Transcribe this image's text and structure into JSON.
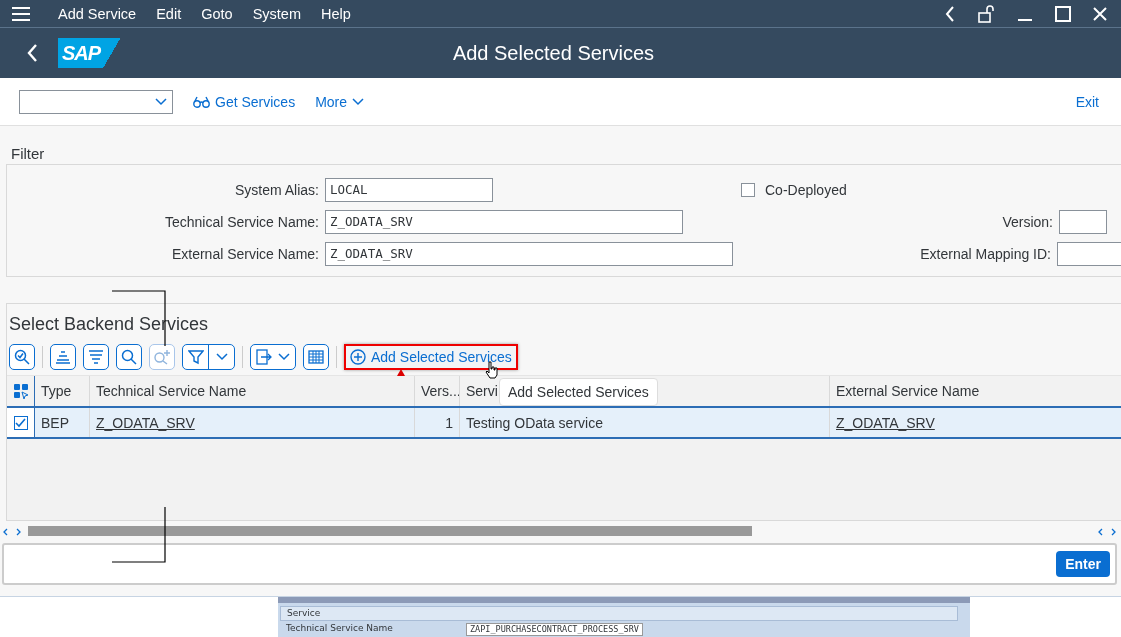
{
  "menu_bar": {
    "items": [
      "Add Service",
      "Edit",
      "Goto",
      "System",
      "Help"
    ]
  },
  "header": {
    "title": "Add Selected Services",
    "logo": "SAP"
  },
  "toolbar": {
    "items": [
      {
        "kind": "dropdown"
      },
      {
        "kind": "glasses",
        "label": "Get Services"
      },
      {
        "kind": "more",
        "label": "More"
      }
    ],
    "exit": "Exit"
  },
  "filter": {
    "title": "Filter",
    "system_alias": {
      "label": "System Alias:",
      "value": "LOCAL"
    },
    "technical_service_name": {
      "label": "Technical Service Name:",
      "value": "Z_ODATA_SRV"
    },
    "external_service_name": {
      "label": "External Service Name:",
      "value": "Z_ODATA_SRV"
    },
    "co_deployed": {
      "label": "Co-Deployed",
      "checked": false
    },
    "version": {
      "label": "Version:"
    },
    "external_mapping_id": {
      "label": "External Mapping ID:"
    }
  },
  "backend": {
    "title": "Select Backend Services",
    "add_button": "Add Selected Services",
    "tooltip": "Add Selected Services",
    "columns": [
      "Type",
      "Technical Service Name",
      "Vers...",
      "Servi",
      "External Service Name"
    ],
    "rows": [
      {
        "selected": true,
        "type": "BEP",
        "technical_service_name": "Z_ODATA_SRV",
        "version": "1",
        "description": "Testing OData service",
        "external_service_name": "Z_ODATA_SRV"
      }
    ]
  },
  "command_bar": {
    "enter": "Enter"
  },
  "embedded": {
    "section": "Service",
    "label": "Technical Service Name",
    "value": "ZAPI_PURCHASECONTRACT_PROCESS_SRV"
  }
}
